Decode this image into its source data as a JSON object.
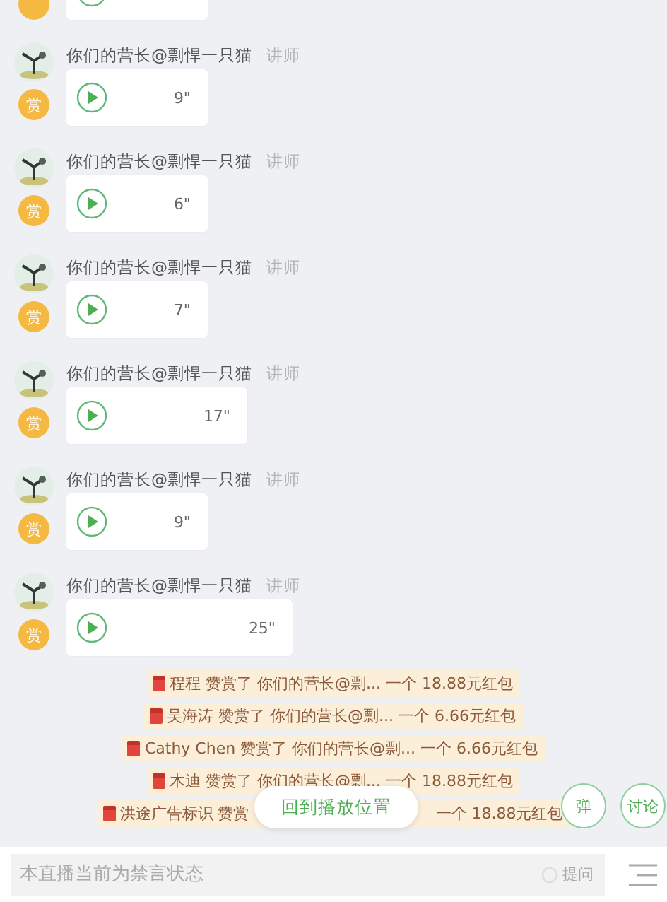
{
  "messages": [
    {
      "kind": "clipped"
    },
    {
      "kind": "voice",
      "name": "你们的营长@剽悍一只猫",
      "role": "讲师",
      "badge": "赏",
      "duration": "9\""
    },
    {
      "kind": "voice",
      "name": "你们的营长@剽悍一只猫",
      "role": "讲师",
      "badge": "赏",
      "duration": "6\""
    },
    {
      "kind": "voice",
      "name": "你们的营长@剽悍一只猫",
      "role": "讲师",
      "badge": "赏",
      "duration": "7\""
    },
    {
      "kind": "voice",
      "name": "你们的营长@剽悍一只猫",
      "role": "讲师",
      "badge": "赏",
      "duration": "17\""
    },
    {
      "kind": "voice",
      "name": "你们的营长@剽悍一只猫",
      "role": "讲师",
      "badge": "赏",
      "duration": "9\""
    },
    {
      "kind": "voice",
      "name": "你们的营长@剽悍一只猫",
      "role": "讲师",
      "badge": "赏",
      "duration": "25\""
    }
  ],
  "rewards": [
    {
      "parts": [
        "程程 赞赏了 你们的营长@剽... 一个 18.88元红包"
      ]
    },
    {
      "parts": [
        "吴海涛 赞赏了 你们的营长@剽... 一个 6.66元红包"
      ]
    },
    {
      "parts": [
        "Cathy Chen 赞赏了 你们的营长@剽... 一个 6.66元红包"
      ]
    },
    {
      "parts": [
        "木迪 赞赏了 你们的营长@剽... 一个 18.88元红包"
      ]
    },
    {
      "parts": [
        "洪途广告标识 赞赏",
        "一个 18.88元红包"
      ]
    }
  ],
  "back_button": "回到播放位置",
  "round_buttons": [
    "弹",
    "讨论"
  ],
  "input": {
    "placeholder": "本直播当前为禁言状态",
    "ask": "提问"
  }
}
